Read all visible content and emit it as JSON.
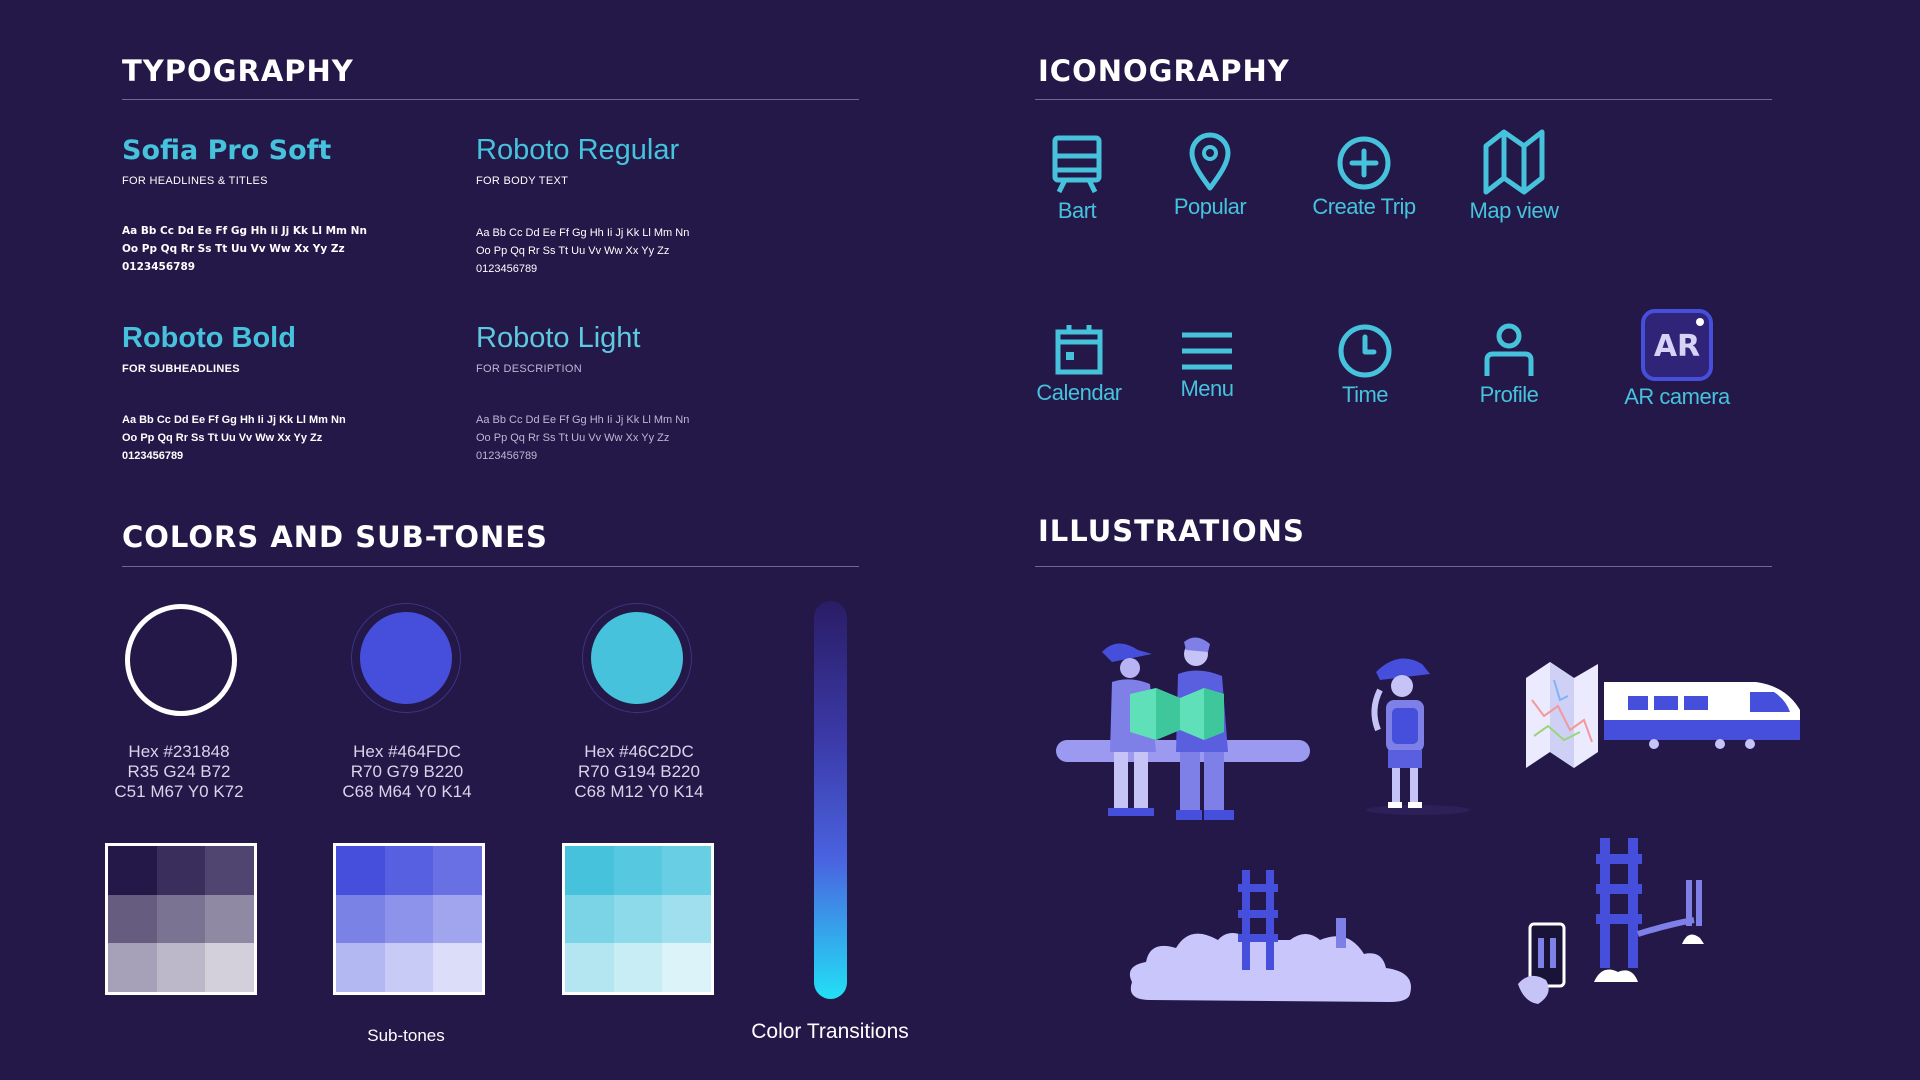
{
  "typography": {
    "title": "TYPOGRAPHY",
    "fonts": [
      {
        "name": "Sofia Pro Soft",
        "use": "FOR HEADLINES & TITLES"
      },
      {
        "name": "Roboto Regular",
        "use": "FOR BODY TEXT"
      },
      {
        "name": "Roboto Bold",
        "use": "FOR SUBHEADLINES"
      },
      {
        "name": "Roboto Light",
        "use": "FOR DESCRIPTION"
      }
    ],
    "sample_line1": "Aa Bb Cc Dd Ee Ff Gg Hh Ii Jj Kk Ll Mm Nn",
    "sample_line2": "Oo Pp Qq Rr Ss Tt Uu Vv Ww Xx Yy Zz",
    "sample_line3": "0123456789"
  },
  "iconography": {
    "title": "ICONOGRAPHY",
    "icons": [
      {
        "label": "Bart",
        "icon": "train-icon"
      },
      {
        "label": "Popular",
        "icon": "location-pin-icon"
      },
      {
        "label": "Create Trip",
        "icon": "plus-circle-icon"
      },
      {
        "label": "Map view",
        "icon": "map-icon"
      },
      {
        "label": "Calendar",
        "icon": "calendar-icon"
      },
      {
        "label": "Menu",
        "icon": "menu-icon"
      },
      {
        "label": "Time",
        "icon": "clock-icon"
      },
      {
        "label": "Profile",
        "icon": "profile-icon"
      },
      {
        "label": "AR camera",
        "icon": "ar-camera-icon",
        "badge": "AR"
      }
    ]
  },
  "colors": {
    "title": "COLORS AND SUB-TONES",
    "swatches": [
      {
        "hex_label": "Hex #231848",
        "rgb": "R35 G24 B72",
        "cmyk": "C51 M67 Y0 K72",
        "color": "#231848"
      },
      {
        "hex_label": "Hex #464FDC",
        "rgb": "R70 G79 B220",
        "cmyk": "C68 M64 Y0 K14",
        "color": "#464FDC"
      },
      {
        "hex_label": "Hex #46C2DC",
        "rgb": "R70 G194 B220",
        "cmyk": "C68 M12 Y0 K14",
        "color": "#46C2DC"
      }
    ],
    "subtones_label": "Sub-tones",
    "transitions_label": "Color Transitions",
    "gradient_top": "#2a1d66",
    "gradient_bottom": "#22e0f5"
  },
  "illustrations": {
    "title": "ILLUSTRATIONS"
  },
  "accent": "#46C2DC",
  "background": "#231848"
}
